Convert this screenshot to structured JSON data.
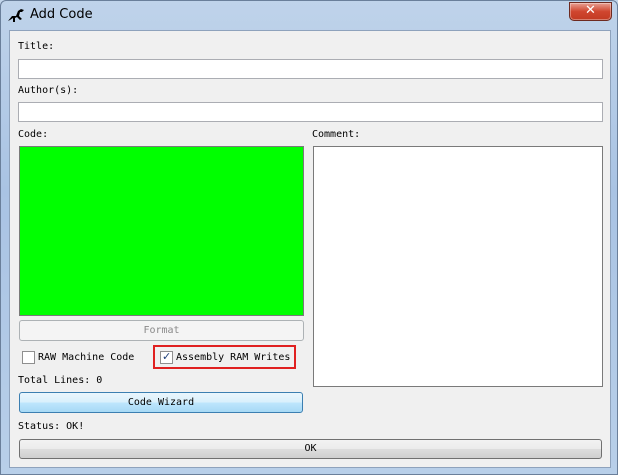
{
  "window": {
    "title": "Add Code",
    "close_glyph": "✕"
  },
  "form": {
    "title_label": "Title:",
    "title_value": "",
    "authors_label": "Author(s):",
    "authors_value": "",
    "code_label": "Code:",
    "comment_label": "Comment:",
    "format_button": "Format",
    "raw_checkbox_label": "RAW Machine Code",
    "raw_checked": false,
    "asm_checkbox_label": "Assembly RAM Writes",
    "asm_checked": true,
    "check_glyph": "✓",
    "total_lines": "Total Lines: 0",
    "wizard_button": "Code Wizard",
    "status": "Status: OK!",
    "ok_button": "OK"
  },
  "colors": {
    "code_background": "#00ff00",
    "highlight_border": "#e02020",
    "close_button": "#c8432c"
  },
  "icons": {
    "app": "dinosaur-icon",
    "close": "close-icon",
    "check": "checkmark-icon"
  }
}
